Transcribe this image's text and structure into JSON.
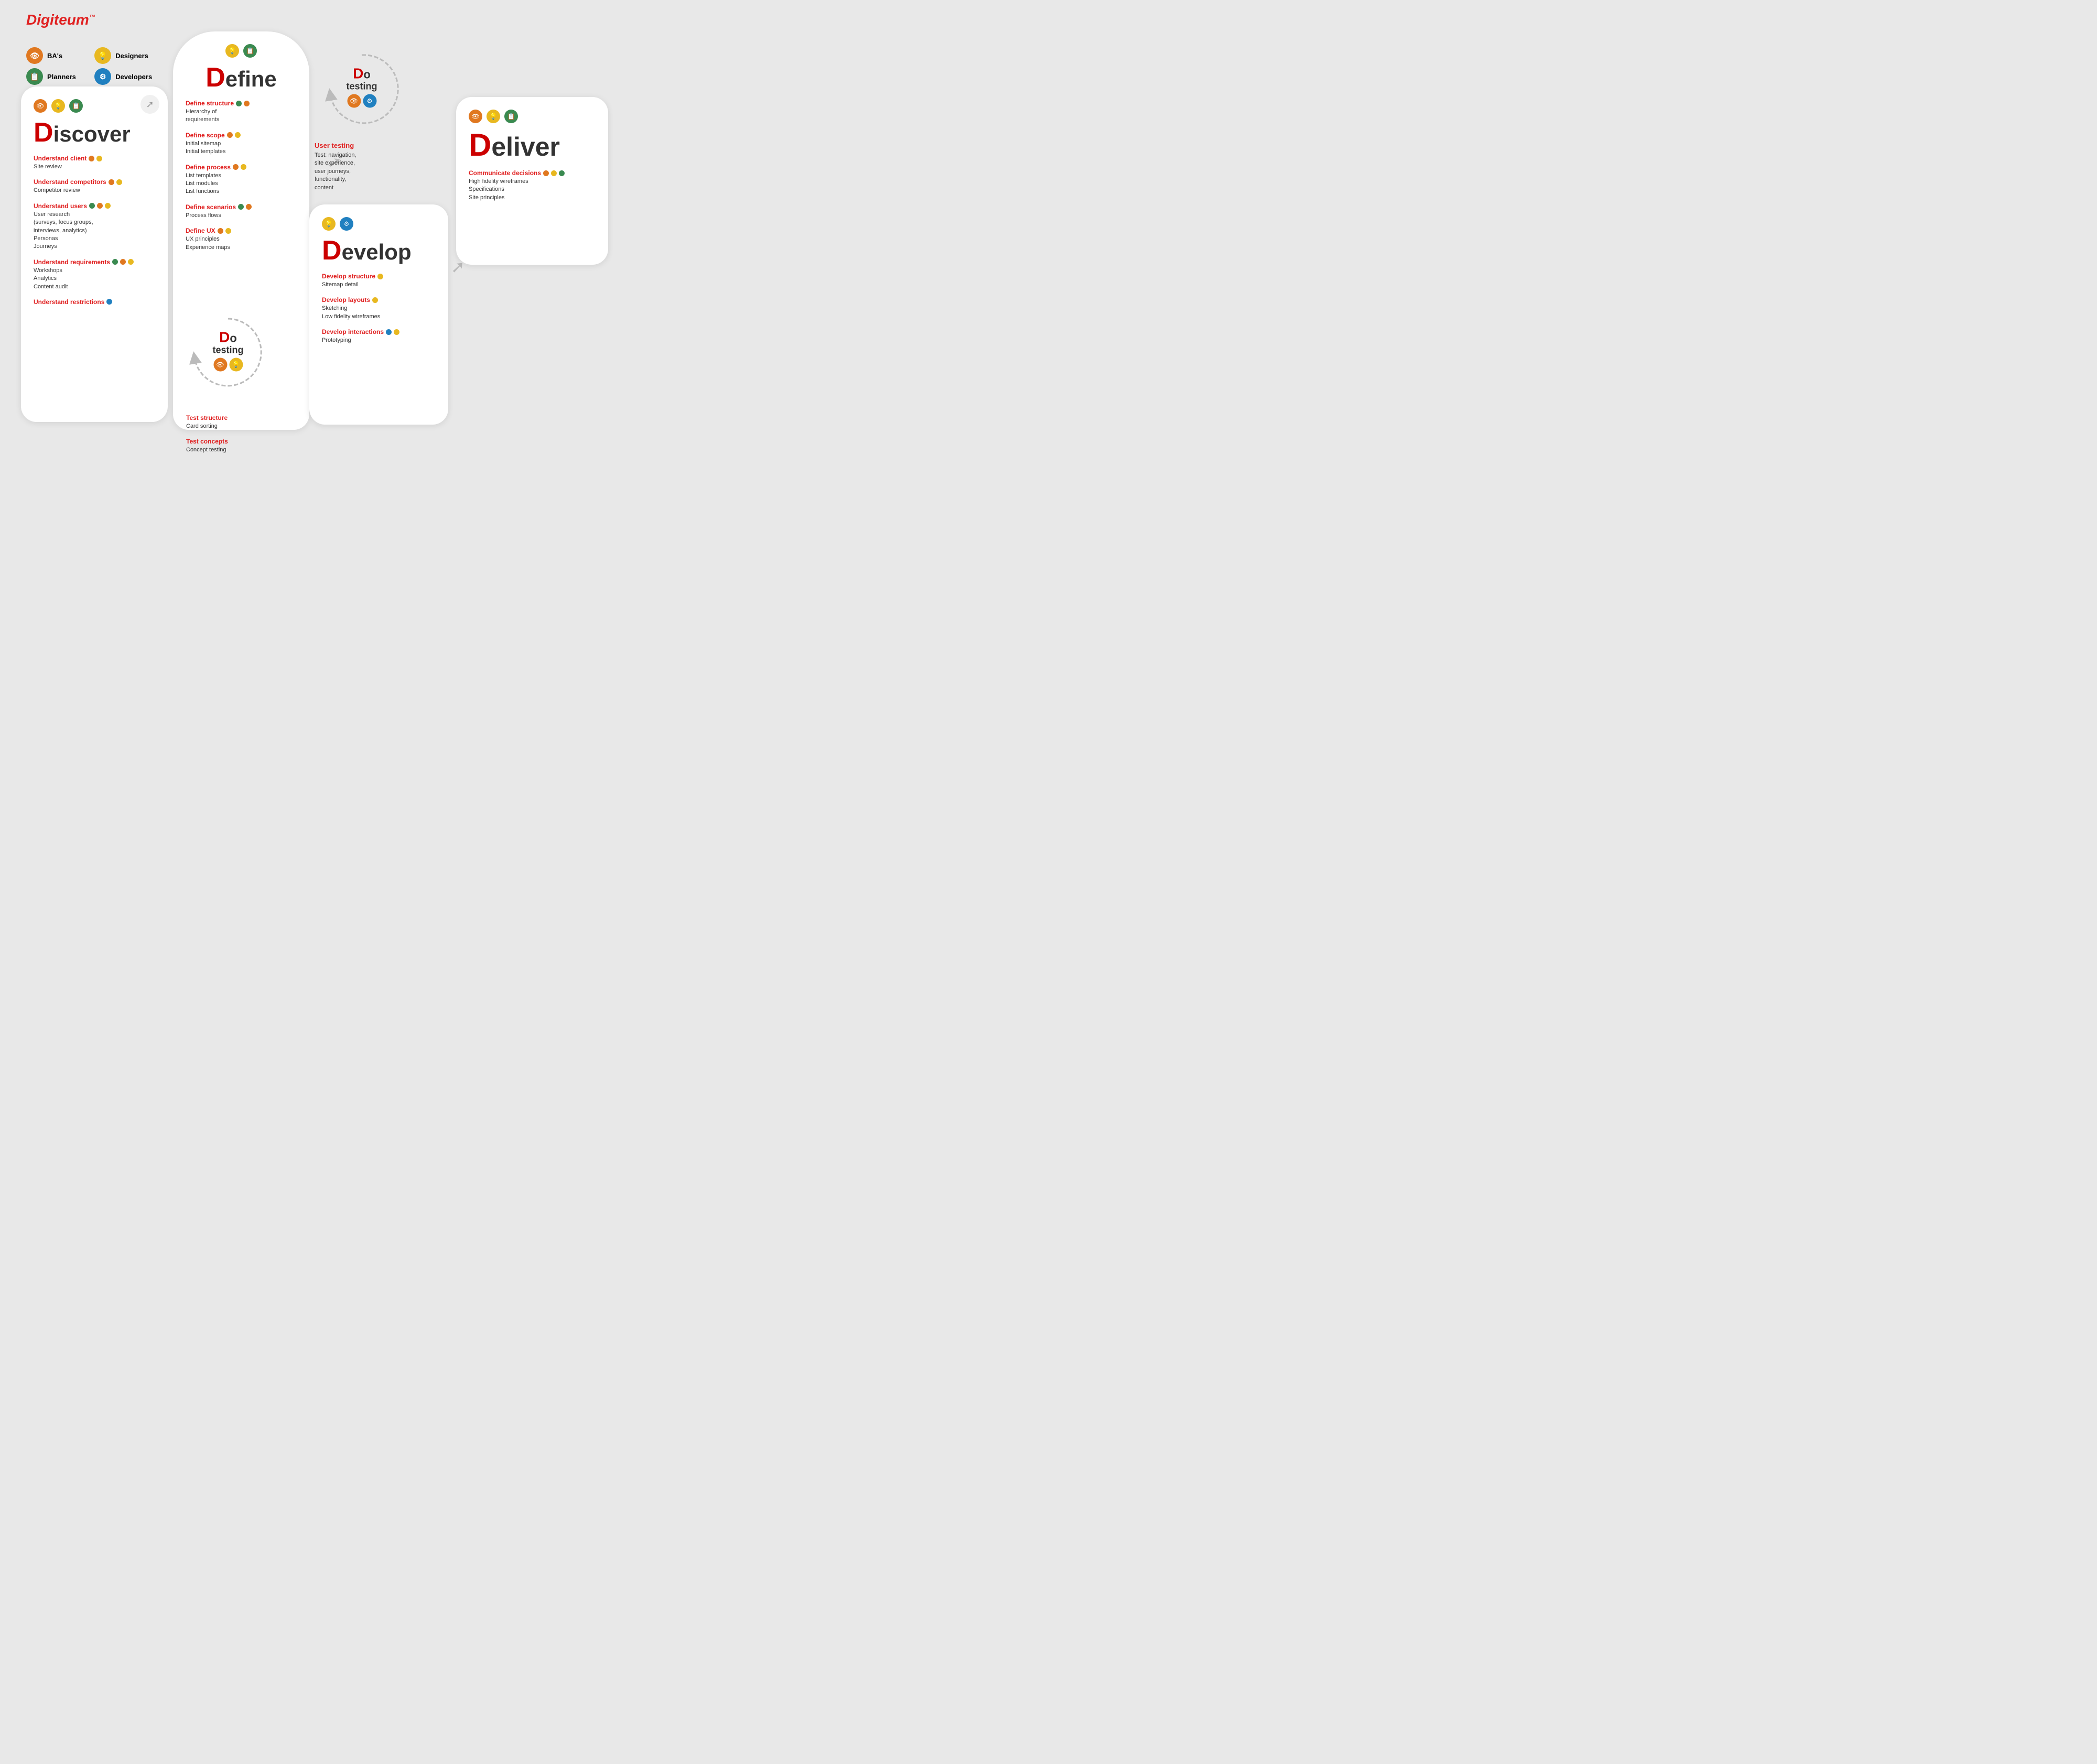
{
  "logo": {
    "text": "Digiteum",
    "trademark": "™"
  },
  "roles": [
    {
      "id": "bas",
      "label": "BA's",
      "icon": "👁",
      "color": "orange"
    },
    {
      "id": "designers",
      "label": "Designers",
      "icon": "💡",
      "color": "yellow"
    },
    {
      "id": "planners",
      "label": "Planners",
      "icon": "📋",
      "color": "green"
    },
    {
      "id": "developers",
      "label": "Developers",
      "icon": "⚙",
      "color": "teal"
    }
  ],
  "discover": {
    "title_big": "D",
    "title_rest": "iscover",
    "items": [
      {
        "title": "Understand client",
        "dots": [
          "orange",
          "yellow"
        ],
        "text": "Site review"
      },
      {
        "title": "Understand competitors",
        "dots": [
          "orange",
          "yellow"
        ],
        "text": "Competitor review"
      },
      {
        "title": "Understand users",
        "dots": [
          "green",
          "orange",
          "yellow"
        ],
        "text": "User research\n(surveys, focus groups,\ninterviews, analytics)\nPersonas\nJourneys"
      },
      {
        "title": "Understand requirements",
        "dots": [
          "green",
          "orange",
          "yellow"
        ],
        "text": "Workshops\nAnalytics\nContent audit"
      },
      {
        "title": "Understand restrictions",
        "dots": [
          "teal"
        ],
        "text": ""
      }
    ]
  },
  "define": {
    "title_big": "D",
    "title_rest": "efine",
    "items": [
      {
        "title": "Define structure",
        "dots": [
          "green",
          "orange"
        ],
        "text": "Hierarchy of\nrequirements"
      },
      {
        "title": "Define scope",
        "dots": [
          "orange",
          "yellow"
        ],
        "text": "Initial sitemap\nInitial templates"
      },
      {
        "title": "Define process",
        "dots": [
          "orange",
          "yellow"
        ],
        "text": "List templates\nList modules\nList functions"
      },
      {
        "title": "Define scenarios",
        "dots": [
          "green",
          "orange"
        ],
        "text": "Process flows"
      },
      {
        "title": "Define UX",
        "dots": [
          "orange",
          "yellow"
        ],
        "text": "UX principles\nExperience maps"
      }
    ]
  },
  "testing_top": {
    "title_big": "D",
    "title_prefix": "o",
    "title_sub": "testing",
    "icons": [
      "orange",
      "teal"
    ],
    "user_testing_title": "User testing",
    "user_testing_text": "Test: navigation,\nsite experience,\nuser journeys,\nfunctionality,\ncontent"
  },
  "develop": {
    "title_big": "D",
    "title_rest": "evelop",
    "items": [
      {
        "title": "Develop structure",
        "dots": [
          "yellow"
        ],
        "text": "Sitemap detail"
      },
      {
        "title": "Develop layouts",
        "dots": [
          "yellow"
        ],
        "text": "Sketching\nLow fidelity wireframes"
      },
      {
        "title": "Develop interactions",
        "dots": [
          "teal",
          "yellow"
        ],
        "text": "Prototyping"
      }
    ]
  },
  "testing_bottom": {
    "title_big": "D",
    "title_prefix": "o",
    "title_sub": "testing",
    "icons": [
      "orange",
      "yellow"
    ],
    "items": [
      {
        "title": "Test structure",
        "text": "Card sorting"
      },
      {
        "title": "Test concepts",
        "text": "Concept testing"
      }
    ]
  },
  "deliver": {
    "title_big": "D",
    "title_rest": "eliver",
    "icons": [
      "orange",
      "yellow",
      "green"
    ],
    "items": [
      {
        "title": "Communicate decisions",
        "dots": [
          "orange",
          "yellow",
          "green"
        ],
        "text": "High fidelity wireframes\nSpecifications\nSite principles"
      }
    ]
  },
  "arrows": {
    "right": "➚",
    "circle": "↻"
  }
}
